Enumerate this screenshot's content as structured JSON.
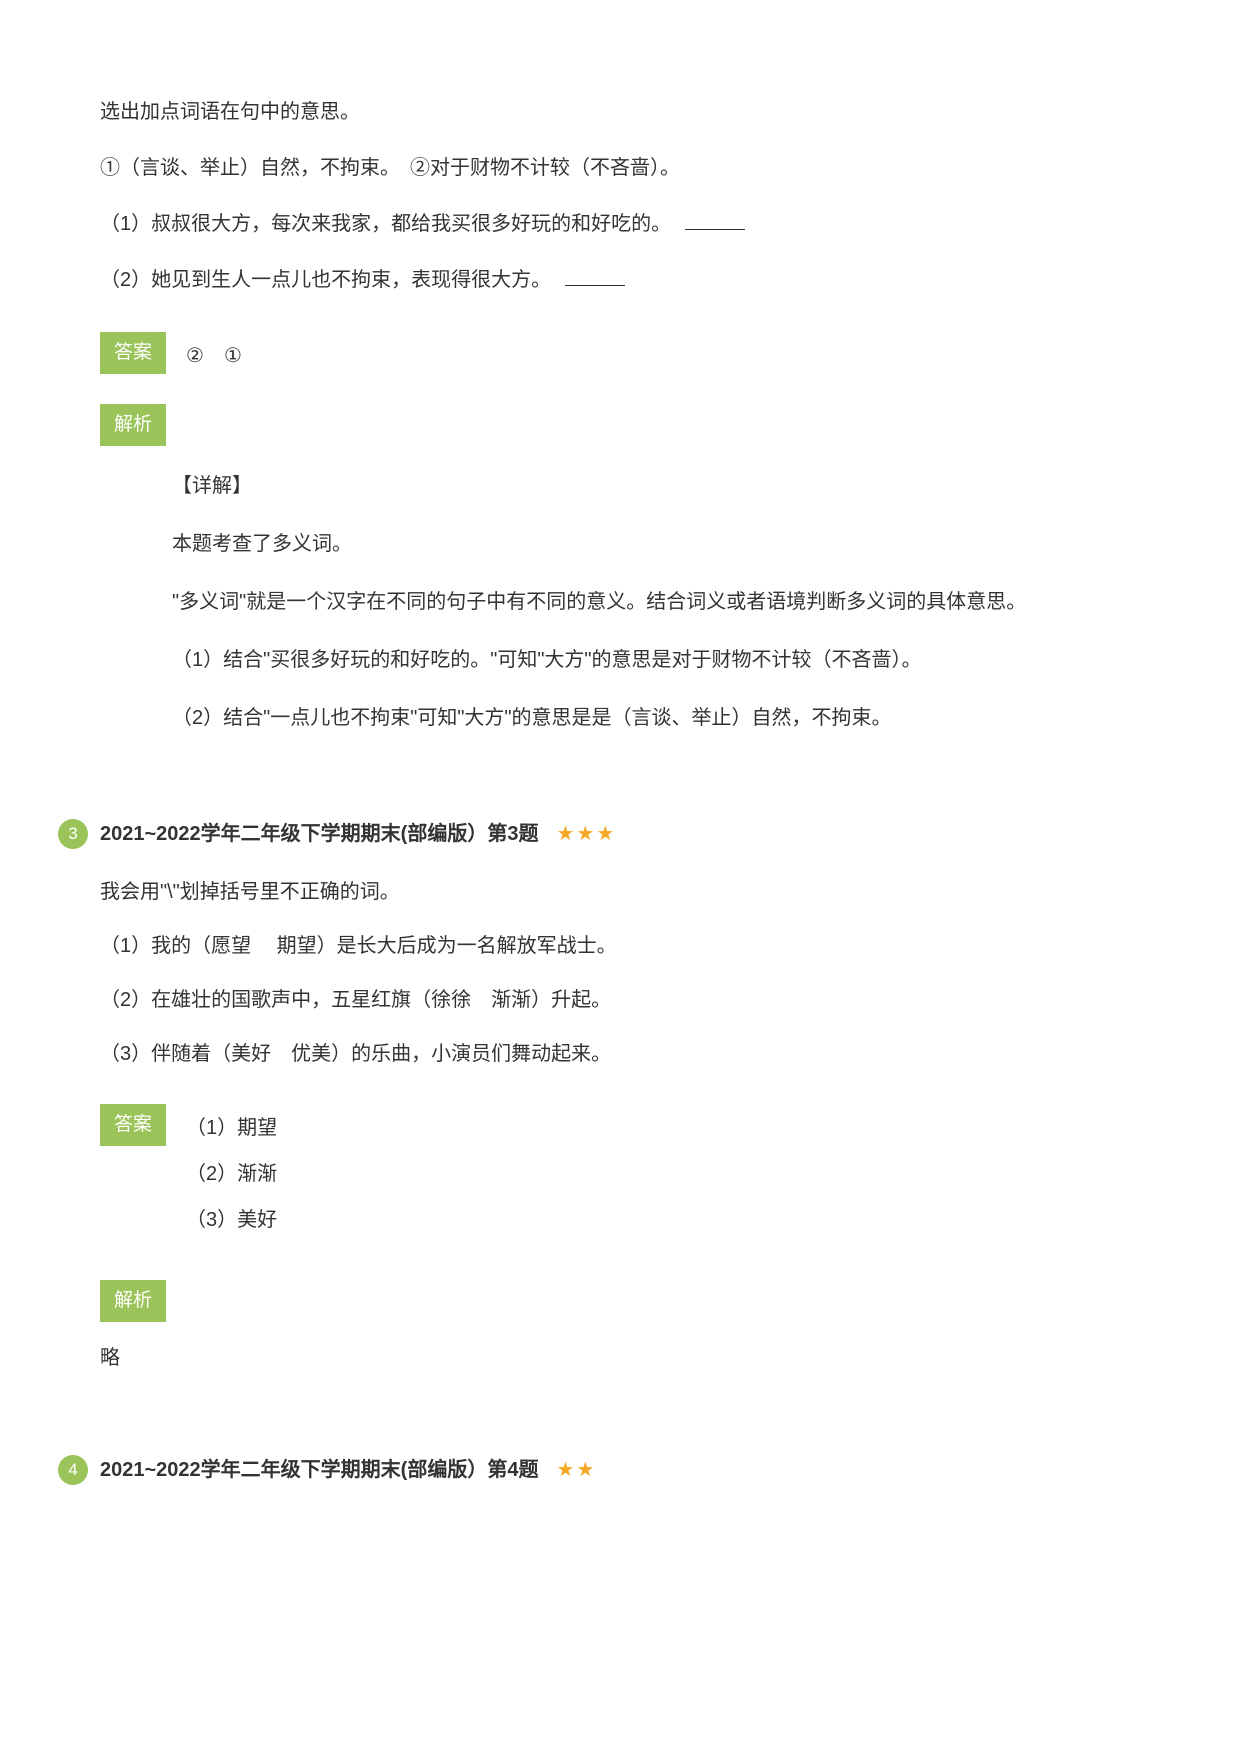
{
  "q1": {
    "intro": "选出加点词语在句中的意思。",
    "option1": "①（言谈、举止）自然，不拘束。　②对于财物不计较（不吝啬）。",
    "line1": "（1）叔叔很大方，每次来我家，都给我买很多好玩的和好吃的。",
    "line2": "（2）她见到生人一点儿也不拘束，表现得很大方。",
    "answer_label": "答案",
    "answer_text": "②　①",
    "explain_label": "解析",
    "detail_header": "【详解】",
    "detail_l1": "本题考查了多义词。",
    "detail_l2": "\"多义词\"就是一个汉字在不同的句子中有不同的意义。结合词义或者语境判断多义词的具体意思。",
    "detail_l3": "（1）结合\"买很多好玩的和好吃的。\"可知\"大方\"的意思是对于财物不计较（不吝啬）。",
    "detail_l4": "（2）结合\"一点儿也不拘束\"可知\"大方\"的意思是是（言谈、举止）自然，不拘束。"
  },
  "q3": {
    "number": "3",
    "title": "2021~2022学年二年级下学期期末(部编版）第3题",
    "stars": "★★★",
    "intro": "我会用\"\\\"划掉括号里不正确的词。",
    "line1": "（1）我的（愿望　 期望）是长大后成为一名解放军战士。",
    "line2": "（2）在雄壮的国歌声中，五星红旗（徐徐　渐渐）升起。",
    "line3": "（3）伴随着（美好　优美）的乐曲，小演员们舞动起来。",
    "answer_label": "答案",
    "ans1": "（1）期望",
    "ans2": "（2）渐渐",
    "ans3": "（3）美好",
    "explain_label": "解析",
    "explain_text": "略"
  },
  "q4": {
    "number": "4",
    "title": "2021~2022学年二年级下学期期末(部编版）第4题",
    "stars": "★★"
  }
}
